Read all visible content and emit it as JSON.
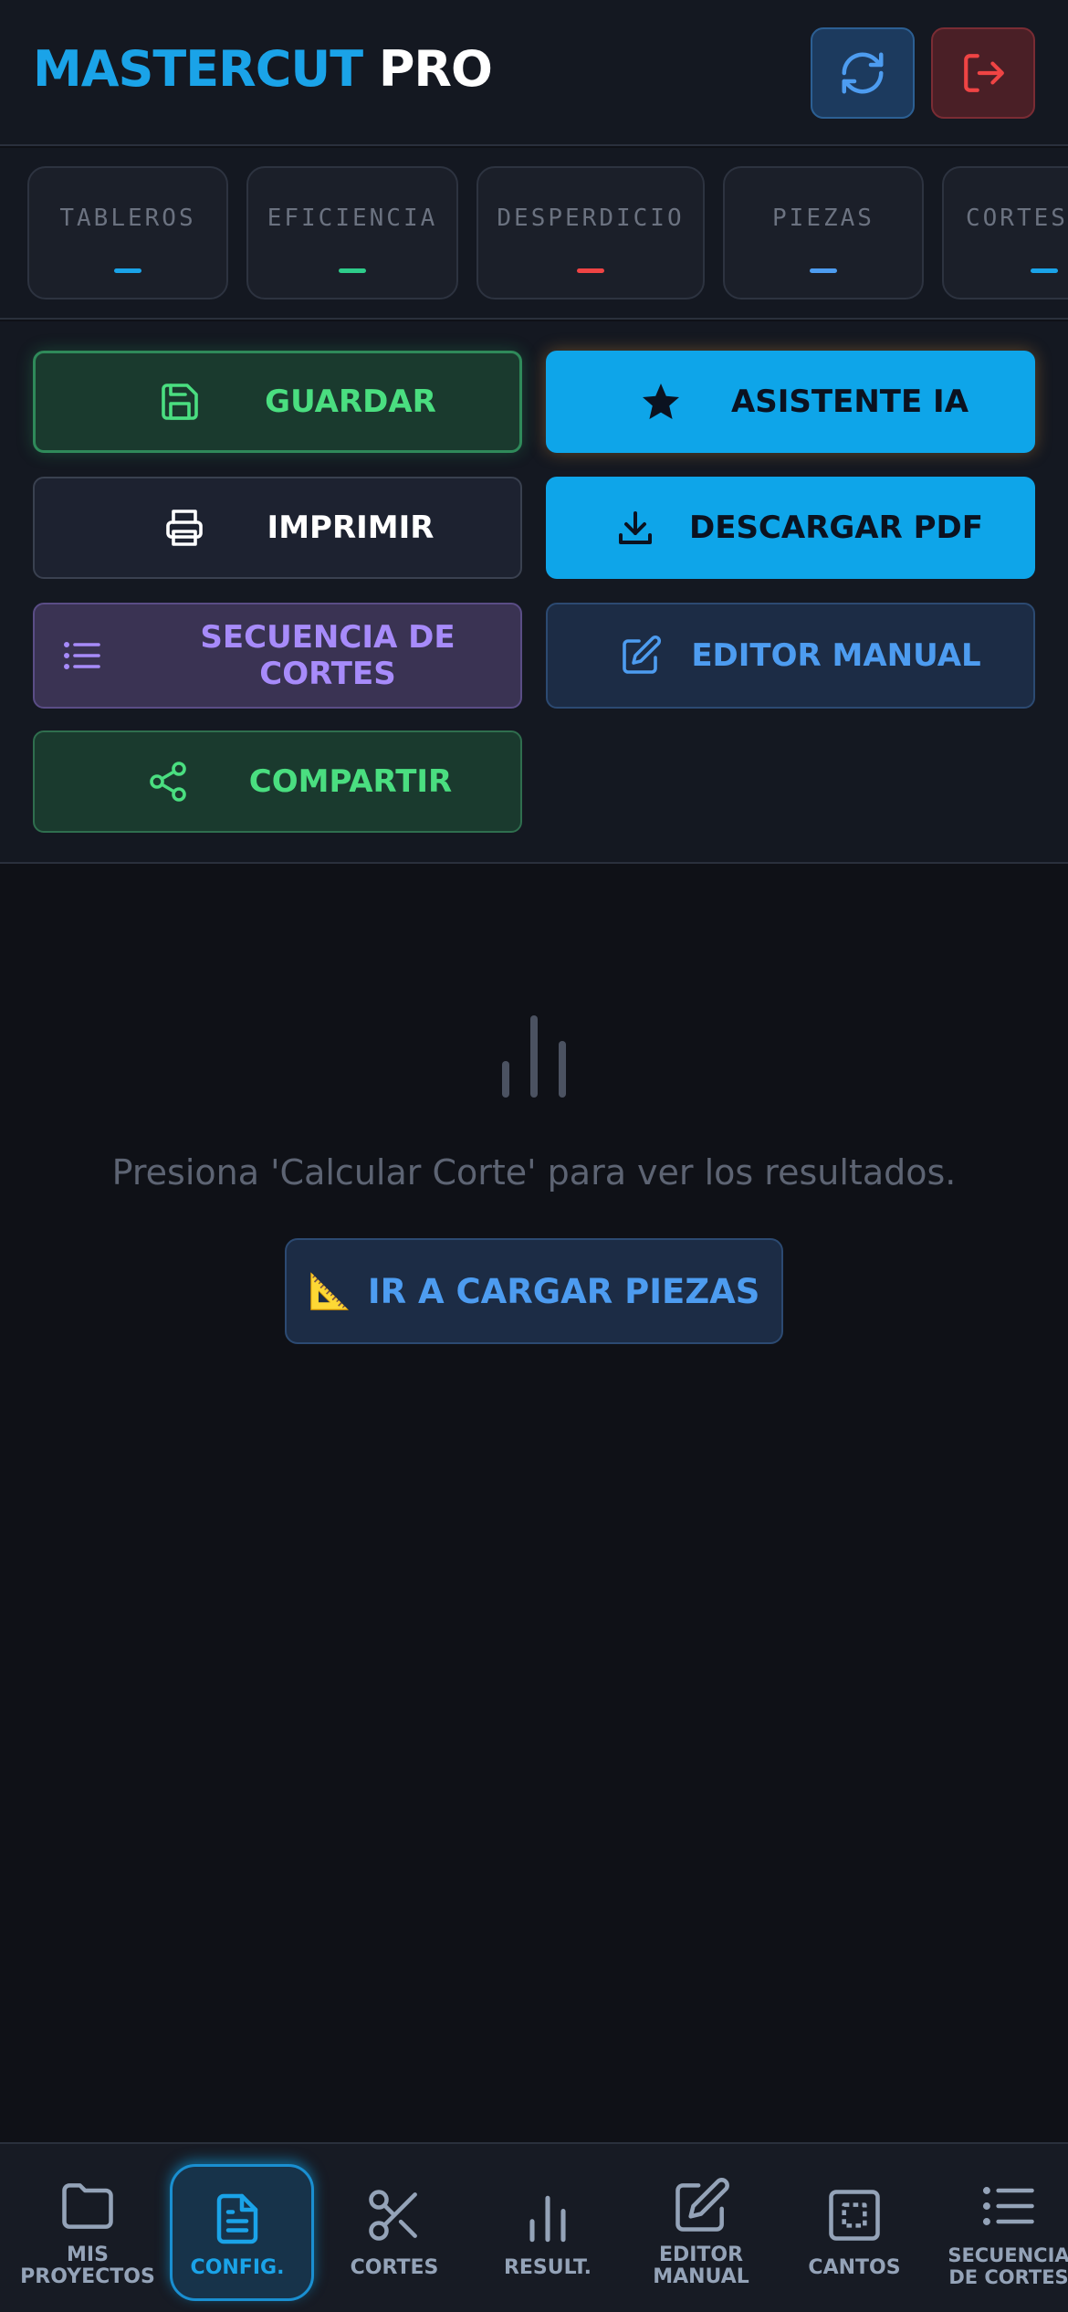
{
  "header": {
    "brand_part1": "MASTERCUT",
    "brand_part2": " PRO",
    "refresh_icon": "refresh-icon",
    "logout_icon": "logout-icon"
  },
  "stats": [
    {
      "label": "TABLEROS",
      "value": "—",
      "color": "#1aa3e8"
    },
    {
      "label": "EFICIENCIA",
      "value": "—",
      "color": "#2ecc8a"
    },
    {
      "label": "DESPERDICIO",
      "value": "—",
      "color": "#ef4444"
    },
    {
      "label": "PIEZAS",
      "value": "—",
      "color": "#4d9cf0"
    },
    {
      "label": "CORTES",
      "value": "—",
      "color": "#1aa3e8"
    }
  ],
  "actions": {
    "guardar": "GUARDAR",
    "asistente": "ASISTENTE IA",
    "imprimir": "IMPRIMIR",
    "descargar_pdf": "DESCARGAR PDF",
    "secuencia_line1": "SECUENCIA DE",
    "secuencia_line2": "CORTES",
    "editor_manual": "EDITOR MANUAL",
    "compartir": "COMPARTIR"
  },
  "empty_state": {
    "message": "Presiona 'Calcular Corte' para ver los resultados.",
    "goto_button": "IR A CARGAR PIEZAS",
    "goto_icon": "📐"
  },
  "bottom_nav": [
    {
      "line1": "MIS",
      "line2": "PROYECTOS",
      "icon": "folder-icon"
    },
    {
      "line1": "CONFIG.",
      "line2": "",
      "icon": "document-icon",
      "active": true
    },
    {
      "line1": "CORTES",
      "line2": "",
      "icon": "scissors-icon"
    },
    {
      "line1": "RESULT.",
      "line2": "",
      "icon": "bar-chart-icon"
    },
    {
      "line1": "EDITOR",
      "line2": "MANUAL",
      "icon": "edit-icon"
    },
    {
      "line1": "CANTOS",
      "line2": "",
      "icon": "square-dashed-icon"
    },
    {
      "line1": "SECUENCIA",
      "line2": "DE CORTES",
      "icon": "list-icon"
    }
  ],
  "colors": {
    "accent": "#1aa3e8",
    "background": "#0f1117",
    "success": "#4ade80",
    "danger": "#ef4444",
    "purple": "#a78bfa"
  }
}
